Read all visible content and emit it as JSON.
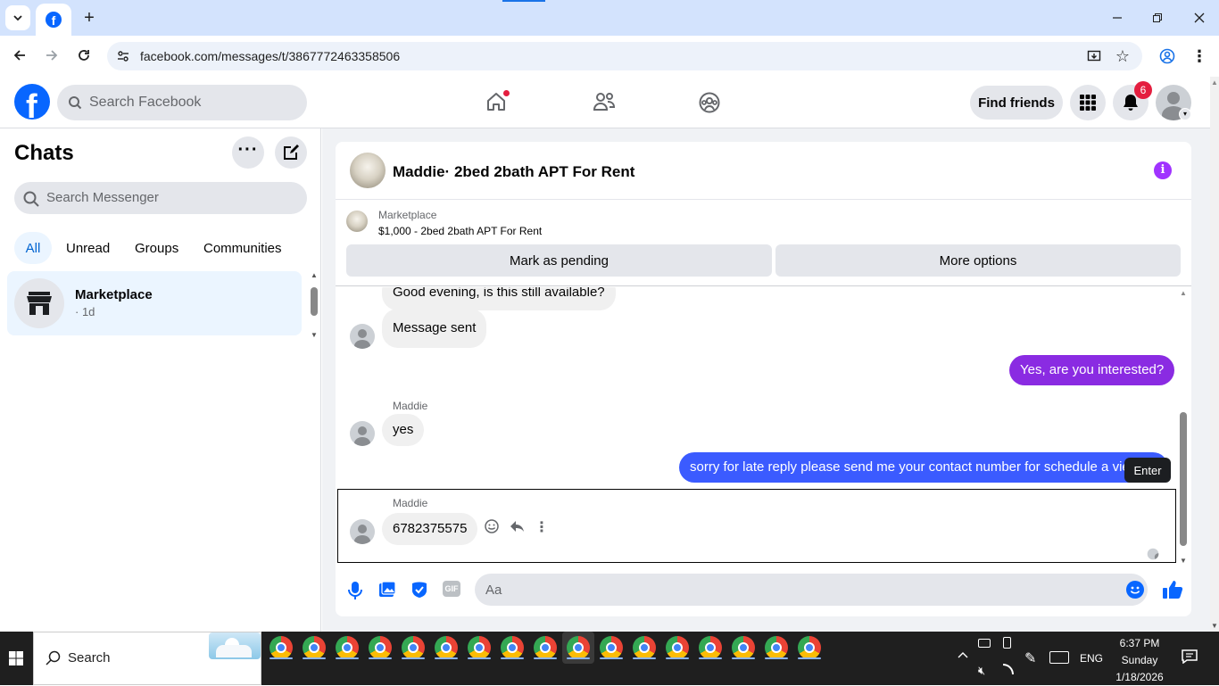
{
  "browser": {
    "url": "facebook.com/messages/t/3867772463358506"
  },
  "header": {
    "search_placeholder": "Search Facebook",
    "find_friends": "Find friends",
    "notification_count": "6"
  },
  "chats": {
    "title": "Chats",
    "search_placeholder": "Search Messenger",
    "filters": [
      "All",
      "Unread",
      "Groups",
      "Communities"
    ],
    "items": [
      {
        "name": "Marketplace",
        "meta": "· 1d"
      }
    ]
  },
  "conversation": {
    "title": "Maddie· 2bed 2bath APT For Rent",
    "listing_source": "Marketplace",
    "listing_title": "$1,000 - 2bed 2bath APT For Rent",
    "mark_pending": "Mark as pending",
    "more_options": "More options",
    "messages": [
      {
        "dir": "in",
        "text": "Good evening, is this still available?"
      },
      {
        "dir": "in",
        "text": "Message sent"
      },
      {
        "dir": "out",
        "text": "Yes, are you interested?"
      },
      {
        "dir": "in",
        "sender": "Maddie",
        "text": "yes"
      },
      {
        "dir": "out",
        "text": "sorry for late reply please send me your contact number for schedule a viewing"
      },
      {
        "dir": "in",
        "sender": "Maddie",
        "text": "6782375575"
      }
    ],
    "tooltip": "Enter",
    "composer_placeholder": "Aa"
  },
  "taskbar": {
    "search": "Search",
    "lang": "ENG",
    "time": "6:37 PM",
    "day": "Sunday",
    "date": "1/18/2026"
  },
  "colors": {
    "fb_blue": "#0866ff",
    "outgoing_purple": "#8a2be2",
    "outgoing_blue": "#3b5bff",
    "badge_red": "#e41e3f"
  }
}
